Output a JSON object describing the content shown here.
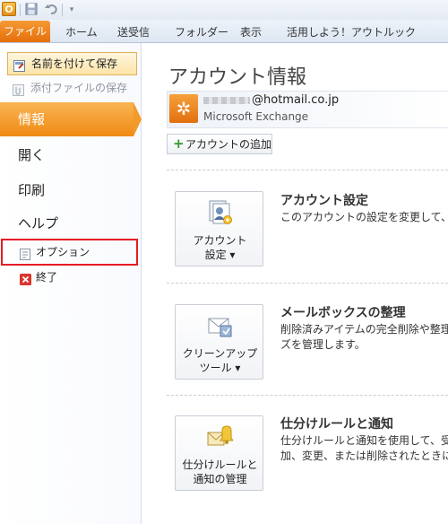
{
  "qat": {
    "app_icon_letter": "O",
    "icons": [
      "save-icon",
      "undo-icon",
      "customize-icon"
    ]
  },
  "tabs": {
    "file": "ファイル",
    "items": [
      "ホーム",
      "送受信",
      "フォルダー",
      "表示",
      "活用しよう！アウトルック"
    ]
  },
  "sidebar": {
    "save_as": "名前を付けて保存",
    "save_attachments": "添付ファイルの保存",
    "active": "情報",
    "open": "開く",
    "print": "印刷",
    "help": "ヘルプ",
    "options": "オプション",
    "exit": "終了"
  },
  "main": {
    "title": "アカウント情報",
    "account": {
      "email_domain": "@hotmail.co.jp",
      "type": "Microsoft Exchange"
    },
    "add_account": "アカウントの追加",
    "sections": [
      {
        "button_line1": "アカウント",
        "button_line2": "設定 ▾",
        "title": "アカウント設定",
        "desc_line1": "このアカウントの設定を変更して、別の"
      },
      {
        "button_line1": "クリーンアップ",
        "button_line2": "ツール ▾",
        "title": "メールボックスの整理",
        "desc_line1": "削除済みアイテムの完全削除や整理",
        "desc_line2": "ズを管理します。"
      },
      {
        "button_line1": "仕分けルールと",
        "button_line2": "通知の管理",
        "title": "仕分けルールと通知",
        "desc_line1": "仕分けルールと通知を使用して、受信",
        "desc_line2": "加、変更、または削除されたときに更"
      }
    ]
  },
  "colors": {
    "file_tab": "#e56f0b",
    "active_nav": "#f08a14",
    "highlight_box": "#e51b24"
  }
}
